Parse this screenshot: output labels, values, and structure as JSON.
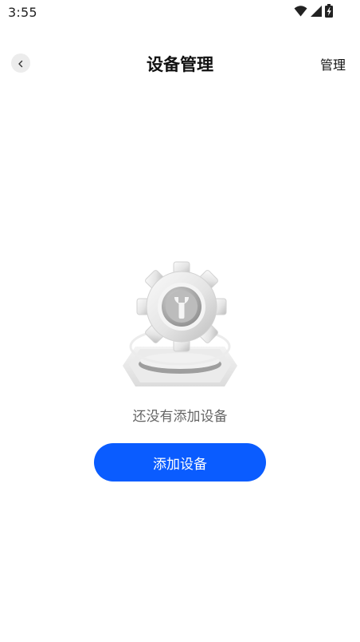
{
  "status_bar": {
    "time": "3:55",
    "icons": [
      "wifi-icon",
      "cell-signal-icon",
      "battery-charging-icon"
    ]
  },
  "nav": {
    "back_icon": "chevron-left-icon",
    "title": "设备管理",
    "manage_label": "管理"
  },
  "empty_state": {
    "illustration": "gear-wrench-icon",
    "message": "还没有添加设备",
    "add_button_label": "添加设备"
  },
  "colors": {
    "primary": "#0a5cff",
    "background": "#ffffff",
    "back_button_bg": "#ececec",
    "muted_text": "#666666"
  }
}
